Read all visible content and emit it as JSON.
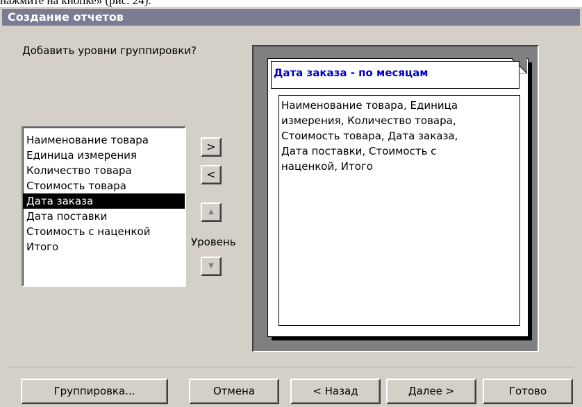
{
  "document_top_text": "нажмите на кнопке» (рис. 24).",
  "window": {
    "title": "Создание отчетов"
  },
  "prompt": "Добавить уровни группировки?",
  "fields": [
    {
      "label": "Наименование товара",
      "selected": false
    },
    {
      "label": "Единица измерения",
      "selected": false
    },
    {
      "label": "Количество товара",
      "selected": false
    },
    {
      "label": "Стоимость товара",
      "selected": false
    },
    {
      "label": "Дата заказа",
      "selected": true
    },
    {
      "label": "Дата поставки",
      "selected": false
    },
    {
      "label": "Стоимость с наценкой",
      "selected": false
    },
    {
      "label": "Итого",
      "selected": false
    }
  ],
  "controls": {
    "add_symbol": ">",
    "remove_symbol": "<",
    "up_symbol": "▲",
    "down_symbol": "▼",
    "level_label": "Уровень"
  },
  "preview": {
    "group_header": "Дата заказа - по месяцам",
    "detail_lines": [
      "Наименование товара, Единица",
      "измерения, Количество товара,",
      "Стоимость товара, Дата заказа,",
      "Дата поставки, Стоимость с",
      "наценкой, Итого"
    ]
  },
  "buttons": {
    "grouping": "Группировка...",
    "cancel": "Отмена",
    "back": "< Назад",
    "next": "Далее >",
    "finish": "Готово"
  },
  "colors": {
    "titlebar": "#7b7b93",
    "dialog_bg": "#d4d0c8",
    "group_header_text": "#0000c0",
    "selection": "#000000"
  }
}
